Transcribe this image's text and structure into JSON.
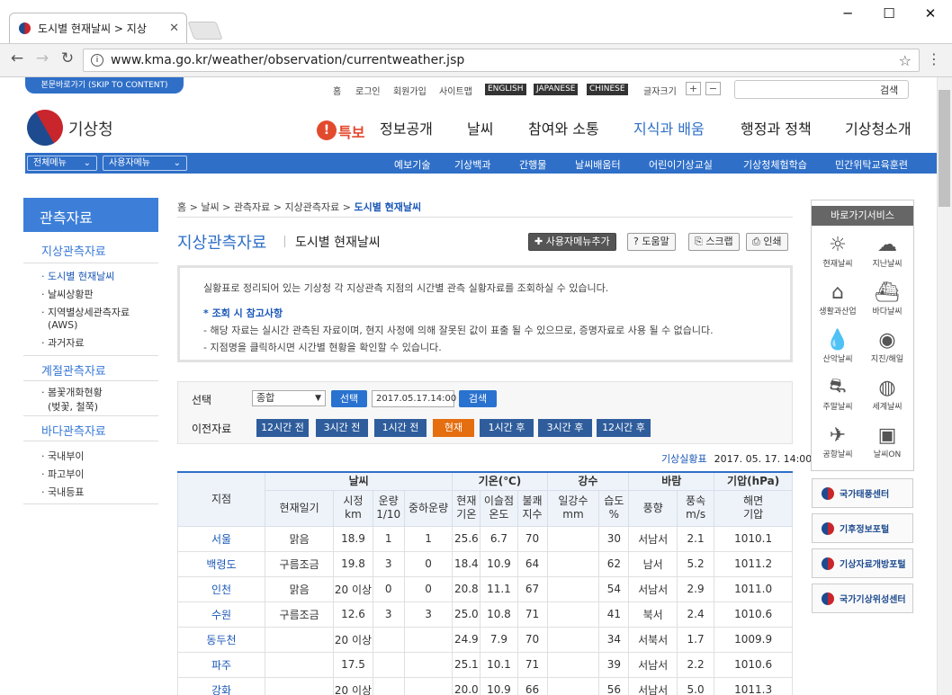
{
  "browser": {
    "tab_title": "도시별 현재날씨 > 지상",
    "url": "www.kma.go.kr/weather/observation/currentweather.jsp"
  },
  "util": {
    "skip": "본문바로가기 (SKIP TO CONTENT)",
    "links": [
      "홈",
      "로그인",
      "회원가입",
      "사이트맵"
    ],
    "langs": [
      "ENGLISH",
      "JAPANESE",
      "CHINESE"
    ],
    "fontsize": "글자크기",
    "search_btn": "검색"
  },
  "header": {
    "logo": "기상청",
    "alert": "특보",
    "gnb": [
      "정보공개",
      "날씨",
      "참여와 소통",
      "지식과 배움",
      "행정과 정책",
      "기상청소개"
    ],
    "allmenu": "전체메뉴",
    "usermenu": "사용자메뉴",
    "sub": [
      "예보기술",
      "기상백과",
      "간행물",
      "날씨배움터",
      "어린이기상교실",
      "기상청체험학습",
      "민간위탁교육훈련"
    ]
  },
  "lnb": {
    "title": "관측자료",
    "h1": "지상관측자료",
    "items1": [
      "도시별 현재날씨",
      "날씨상황판",
      "지역별상세관측자료",
      "(AWS)",
      "과거자료"
    ],
    "h2": "계절관측자료",
    "items2": [
      "봄꽃개화현황",
      "(벚꽃, 철쭉)"
    ],
    "h3": "바다관측자료",
    "items3": [
      "국내부이",
      "파고부이",
      "국내등표"
    ]
  },
  "content": {
    "crumb": [
      "홈",
      "날씨",
      "관측자료",
      "지상관측자료",
      "도시별 현재날씨"
    ],
    "title": "지상관측자료",
    "subtitle": "도시별 현재날씨",
    "btn_addmenu": "사용자메뉴추가",
    "btn_help": "도움말",
    "btn_scrap": "스크랩",
    "btn_print": "인쇄",
    "intro": "실황표로 정리되어 있는 기상청 각 지상관측 지점의 시간별 관측 실황자료를 조회하실 수 있습니다.",
    "hint": "* 조회 시 참고사항",
    "notes": [
      "- 해당 자료는 실시간 관측된 자료이며, 현지 사정에 의해 잘못된 값이 표출 될 수 있으므로, 증명자료로 사용 될 수 없습니다.",
      "- 지점명을 클릭하시면 시간별 현황을 확인할 수 있습니다."
    ],
    "select_label": "선택",
    "select_value": "종합",
    "select_btn": "선택",
    "date_value": "2017.05.17.14:00",
    "search_btn": "검색",
    "prev_label": "이전자료",
    "time_btns": [
      "12시간 전",
      "3시간 전",
      "1시간 전",
      "현재",
      "1시간 후",
      "3시간 후",
      "12시간 후"
    ],
    "meta_link": "기상실황표",
    "meta_time": "2017. 05. 17. 14:00"
  },
  "table": {
    "h_station": "지점",
    "g_weather": "날씨",
    "g_temp": "기온(℃)",
    "g_rain": "강수",
    "g_wind": "바람",
    "g_press": "기압(hPa)",
    "cols": [
      "현재일기",
      "시정\nkm",
      "운량\n1/10",
      "중하운량",
      "현재\n기온",
      "이슬점\n온도",
      "불쾌\n지수",
      "일강수\nmm",
      "습도\n%",
      "풍향",
      "풍속\nm/s",
      "해면\n기압"
    ],
    "rows": [
      [
        "서울",
        "맑음",
        "18.9",
        "1",
        "1",
        "25.6",
        "6.7",
        "70",
        "",
        "30",
        "서남서",
        "2.1",
        "1010.1"
      ],
      [
        "백령도",
        "구름조금",
        "19.8",
        "3",
        "0",
        "18.4",
        "10.9",
        "64",
        "",
        "62",
        "남서",
        "5.2",
        "1011.2"
      ],
      [
        "인천",
        "맑음",
        "20 이상",
        "0",
        "0",
        "20.8",
        "11.1",
        "67",
        "",
        "54",
        "서남서",
        "2.9",
        "1011.0"
      ],
      [
        "수원",
        "구름조금",
        "12.6",
        "3",
        "3",
        "25.0",
        "10.8",
        "71",
        "",
        "41",
        "북서",
        "2.4",
        "1010.6"
      ],
      [
        "동두천",
        "",
        "20 이상",
        "",
        "",
        "24.9",
        "7.9",
        "70",
        "",
        "34",
        "서북서",
        "1.7",
        "1009.9"
      ],
      [
        "파주",
        "",
        "17.5",
        "",
        "",
        "25.1",
        "10.1",
        "71",
        "",
        "39",
        "서남서",
        "2.2",
        "1010.6"
      ],
      [
        "강화",
        "",
        "20 이상",
        "",
        "",
        "20.0",
        "10.9",
        "66",
        "",
        "56",
        "서남서",
        "5.0",
        "1011.3"
      ]
    ]
  },
  "quick": {
    "title": "바로가기서비스",
    "items": [
      {
        "label": "현재날씨",
        "icon": "sun-icon"
      },
      {
        "label": "지난날씨",
        "icon": "cloud-icon"
      },
      {
        "label": "생활과산업",
        "icon": "house-icon"
      },
      {
        "label": "바다날씨",
        "icon": "ship-icon"
      },
      {
        "label": "산악날씨",
        "icon": "drop-icon"
      },
      {
        "label": "지진/해일",
        "icon": "signal-icon"
      },
      {
        "label": "주말날씨",
        "icon": "car-icon"
      },
      {
        "label": "세계날씨",
        "icon": "globe-icon"
      },
      {
        "label": "공항날씨",
        "icon": "plane-icon"
      },
      {
        "label": "날씨ON",
        "icon": "tv-icon"
      }
    ],
    "banners": [
      "국가태풍센터",
      "기후정보포털",
      "기상자료개방포털",
      "국가기상위성센터"
    ]
  }
}
